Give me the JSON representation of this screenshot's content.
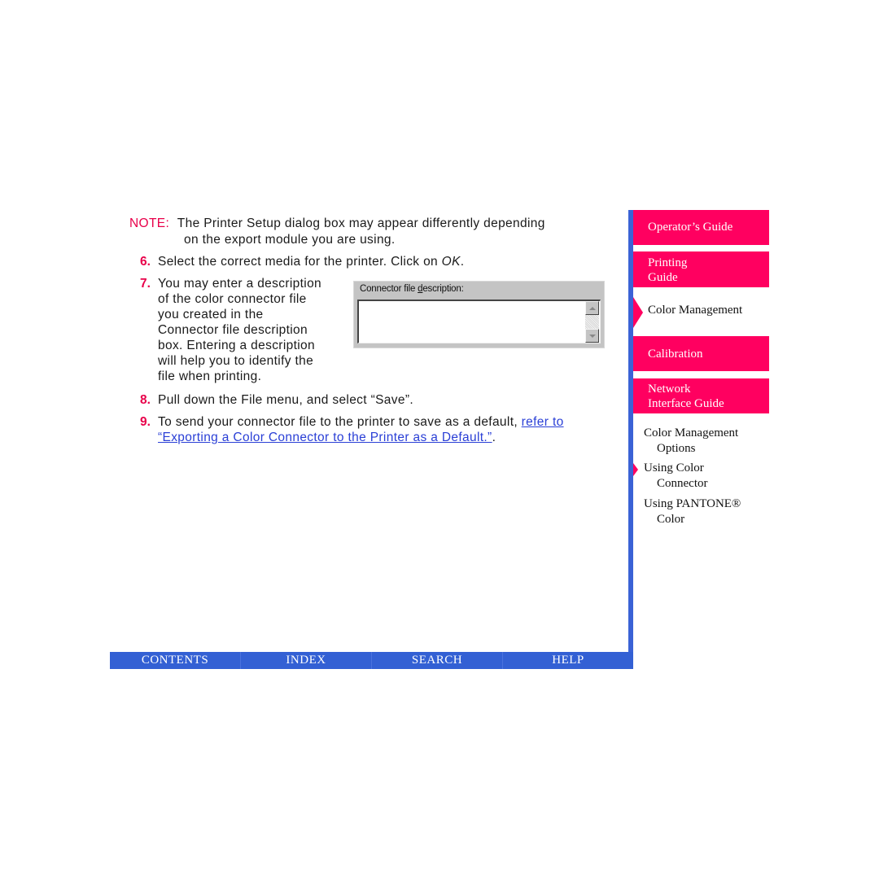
{
  "note": {
    "label": "NOTE:",
    "line1": "The Printer Setup dialog box may appear differently depending",
    "line2": "on the export module you are using."
  },
  "steps": [
    {
      "number": "6.",
      "text": "Select the correct media for the printer. Click on ",
      "emphasis": "OK",
      "suffix": "."
    },
    {
      "number": "7.",
      "lines": [
        "You may enter a description",
        "of the color connector file",
        "you created in the",
        "Connector file description",
        "box. Entering a description",
        "will help you to identify the",
        "file when printing."
      ]
    },
    {
      "number": "8.",
      "text": "Pull down the File menu, and select “Save”."
    },
    {
      "number": "9.",
      "text": "To send your connector file to the printer to save as a default, ",
      "link_part1": "refer to",
      "link_part2": "“Exporting a Color Connector to the Printer as a Default.”",
      "suffix": "."
    }
  ],
  "dialog": {
    "label_before": "Connector file ",
    "label_mnemonic": "d",
    "label_after": "escription:",
    "textarea_value": ""
  },
  "sidebar": {
    "guides": [
      {
        "label_lines": [
          "Operator’s Guide"
        ]
      },
      {
        "label_lines": [
          "Printing",
          "Guide"
        ]
      }
    ],
    "active_section": "Color Management",
    "more_guides": [
      {
        "label_lines": [
          "Calibration"
        ]
      },
      {
        "label_lines": [
          "Network",
          "Interface Guide"
        ]
      }
    ],
    "subsections": [
      {
        "line1": "Color Management",
        "line2": "Options",
        "current": false
      },
      {
        "line1": "Using Color",
        "line2": "Connector",
        "current": true
      },
      {
        "line1": "Using PANTONE®",
        "line2": "Color",
        "current": false
      }
    ]
  },
  "navbar": {
    "items": [
      "CONTENTS",
      "INDEX",
      "SEARCH",
      "HELP"
    ]
  },
  "colors": {
    "accent_pink": "#ff0060",
    "number_red": "#e8004a",
    "nav_blue": "#3360d4",
    "link_blue": "#2a3fd6"
  }
}
